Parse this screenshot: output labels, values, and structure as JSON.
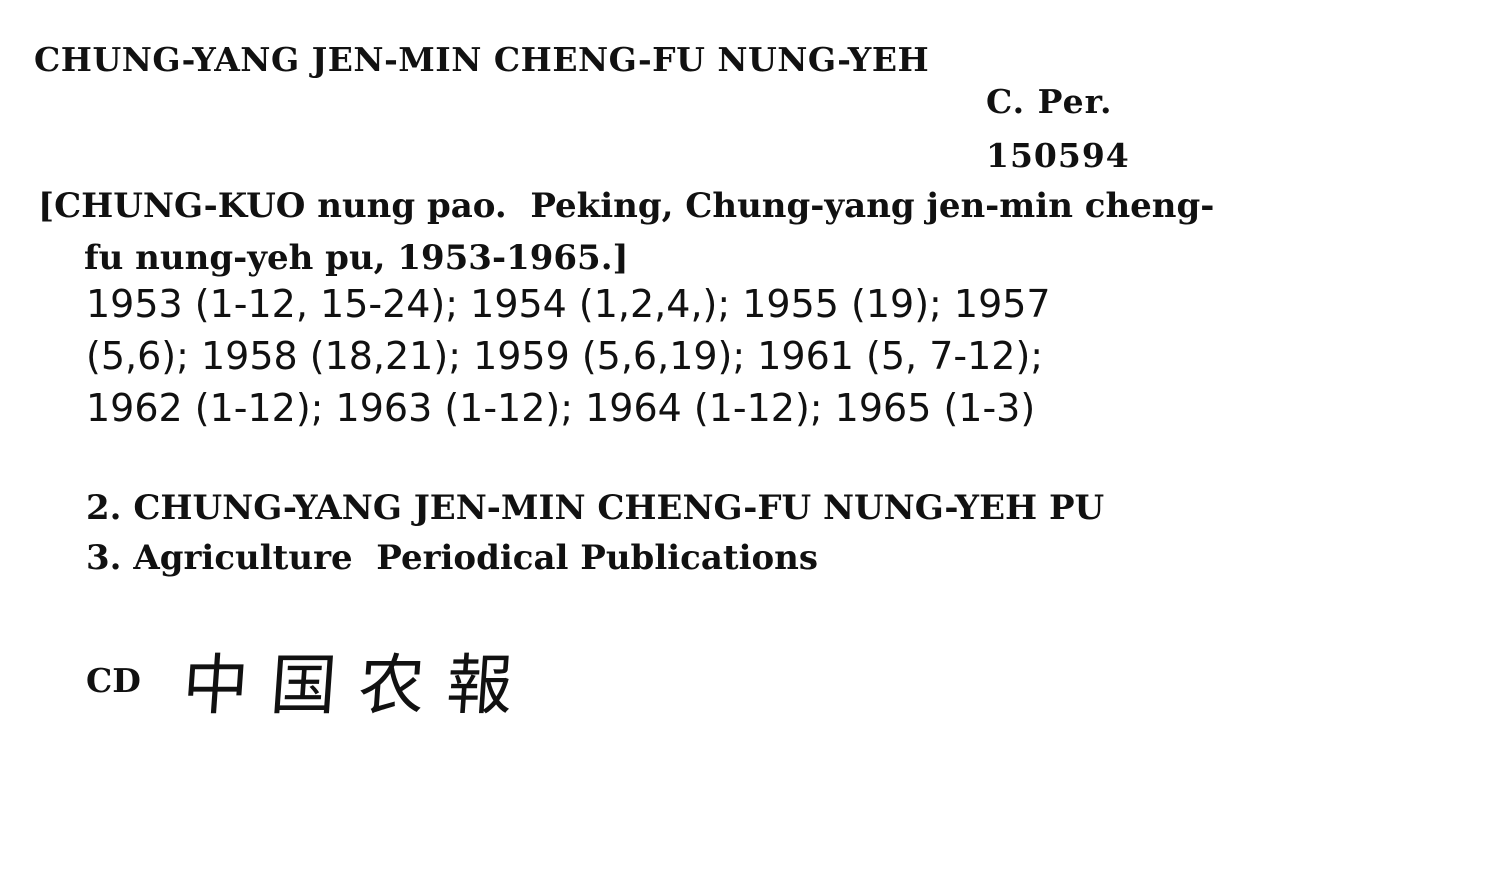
{
  "card": {
    "heading": "CHUNG-YANG JEN-MIN CHENG-FU NUNG-YEH",
    "call_number": {
      "line1": "C. Per.",
      "line2": "150594"
    },
    "title": {
      "line1": "[CHUNG-KUO nung pao.  Peking, Chung-yang jen-min cheng-",
      "line2": "fu nung-yeh pu, 1953-1965.]"
    },
    "holdings": [
      "1953 (1-12, 15-24); 1954 (1,2,4,); 1955 (19); 1957",
      "(5,6); 1958 (18,21); 1959 (5,6,19); 1961 (5, 7-12);",
      "1962 (1-12); 1963 (1-12); 1964 (1-12); 1965 (1-3)"
    ],
    "tracings": {
      "item2": "2. CHUNG-YANG JEN-MIN CHENG-FU NUNG-YEH PU",
      "item3": "3. Agriculture  Periodical Publications"
    },
    "cd": {
      "label": "CD",
      "handwritten": "中国农報"
    }
  }
}
